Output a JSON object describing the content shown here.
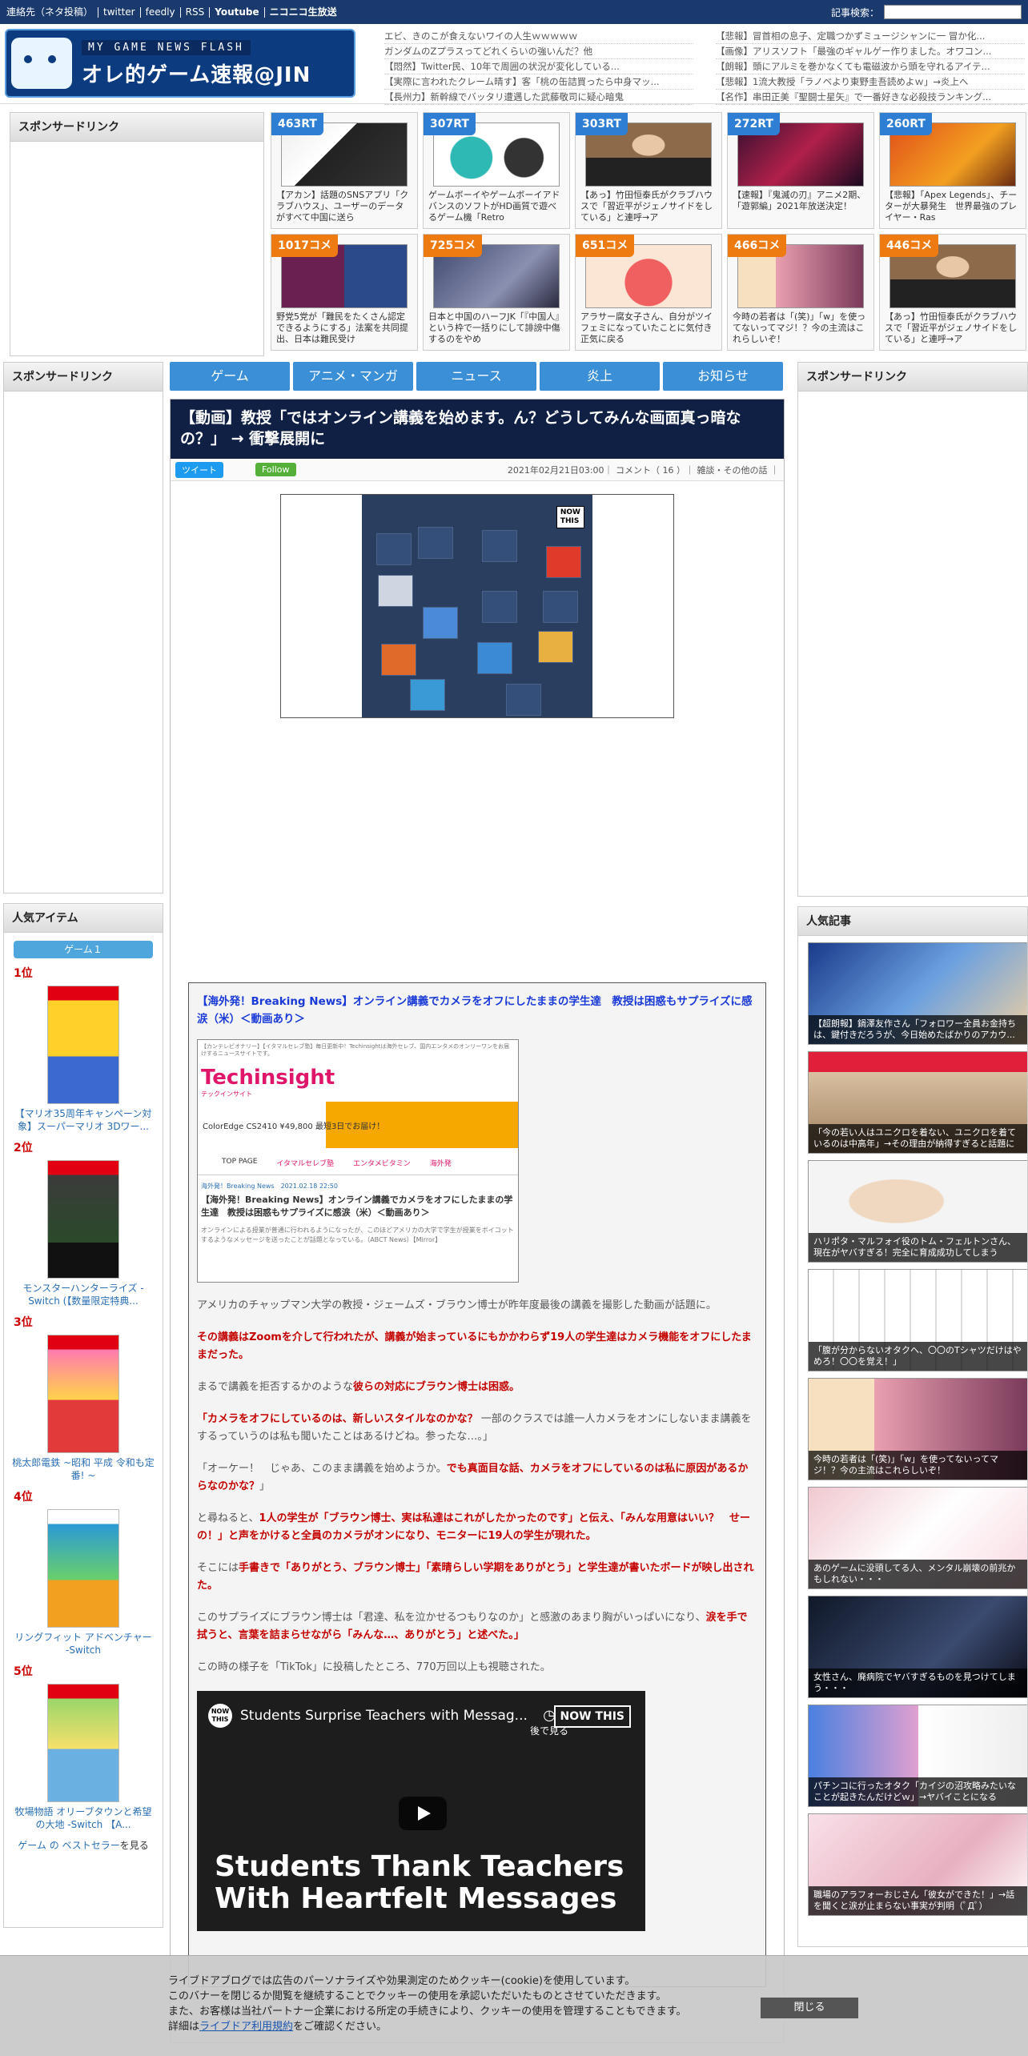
{
  "topbar": {
    "links": [
      "連絡先（ネタ投稿）",
      "twitter",
      "feedly",
      "RSS",
      "Youtube",
      "ニコニコ生放送"
    ],
    "search_label": "記事検索："
  },
  "logo": {
    "sub": "MY GAME NEWS FLASH",
    "main": "オレ的ゲーム速報@JIN"
  },
  "headlines": [
    "エビ、きのこが食えないワイの人生ｗｗｗｗｗ",
    "【悲報】冒首相の息子、定職つかずミュージシャンに一 冒か化...",
    "ガンダムのZプラスってどれくらいの強いんだ？他",
    "【画像】アリスソフト「最強のギャルゲー作りました。オワコン...",
    "【悶然】Twitter民、10年で周囲の状況が変化している...",
    "【朗報】頭にアルミを巻かなくても電磁波から頭を守れるアイテ...",
    "【実際に言われたクレーム晴す】客「桃の缶詰買ったら中身マッ...",
    "【悲報】1流大教授「ラノベより東野圭吾読めよｗ」→炎上へ",
    "【長州力】新幹線でバッタリ遭遇した武藤敬司に疑心暗鬼",
    "【名作】串田正美『聖闘士星矢』で一番好きな必殺技ランキング..."
  ],
  "sponsor_label": "スポンサードリンク",
  "rt_cards": [
    {
      "badge": "463RT",
      "text": "【アカン】話題のSNSアプリ「クラブハウス」、ユーザーのデータがすべて中国に送ら"
    },
    {
      "badge": "307RT",
      "text": "ゲームボーイやゲームボーイアドバンスのソフトがHD画質で遊べるゲーム機「Retro"
    },
    {
      "badge": "303RT",
      "text": "【あっ】竹田恒泰氏がクラブハウスで「習近平がジェノサイドをしている」と連呼→ア"
    },
    {
      "badge": "272RT",
      "text": "【速報】『鬼滅の刃』アニメ2期、「遊郭編」2021年放送決定！"
    },
    {
      "badge": "260RT",
      "text": "【悲報】「Apex Legends」、チーターが大暴発生　世界最強のプレイヤー・Ras"
    },
    {
      "badge": "1017コメ",
      "text": "野党5党が「難民をたくさん認定できるようにする」法案を共同提出、日本は難民受け"
    },
    {
      "badge": "725コメ",
      "text": "日本と中国のハーフJK「『中国人』という枠で一括りにして誹謗中傷するのをやめ"
    },
    {
      "badge": "651コメ",
      "text": "アラサー腐女子さん、自分がツイフェミになっていたことに気付き正気に戻る"
    },
    {
      "badge": "466コメ",
      "text": "今時の若者は「(笑)」「w」を使ってないってマジ！？今の主流はこれらしいぞ！"
    },
    {
      "badge": "446コメ",
      "text": "【あっ】竹田恒泰氏がクラブハウスで「習近平がジェノサイドをしている」と連呼→ア"
    }
  ],
  "nav": [
    "ゲーム",
    "アニメ・マンガ",
    "ニュース",
    "炎上",
    "お知らせ"
  ],
  "article": {
    "title": "【動画】教授「ではオンライン講義を始めます。ん？どうしてみんな画面真っ暗なの？」 → 衝撃展開に",
    "tweet": "ツイート",
    "follow": "Follow",
    "meta": "2021年02月21日03:00｜ コメント（ 16 ）｜ 雑談・その他の話 ｜",
    "quote_title": "【海外発！Breaking News】オンライン講義でカメラをオフにしたままの学生達　教授は困惑もサプライズに感涙（米）＜動画あり＞",
    "qshot": {
      "breadcrumb": "【カンテレビオナリー】【イタマルセレブ塾】毎日更新中！Techinsightは海外セレブ、国内エンタメのオンリーワンをお届けするニュースサイトです。",
      "brand": "Techinsight",
      "brand_sub": "テックインサイト",
      "ad_text": "ColorEdge CS2410 ¥49,800 最短3日でお届け！",
      "nav": [
        "TOP PAGE",
        "イタマルセレブ塾",
        "エンタメビタミン",
        "海外発"
      ],
      "cat": "海外発！Breaking News　2021.02.18 22:50",
      "title": "【海外発！Breaking News】オンライン講義でカメラをオフにしたままの学生達　教授は困惑もサプライズに感涙（米）＜動画あり＞",
      "body": "オンラインによる授業が普通に行われるようになったが、このほどアメリカの大学で学生が授業をボイコットするようなメッセージを送ったことが話題となっている。（ABCT News）【Mirror】"
    },
    "p1": "アメリカのチャップマン大学の教授・ジェームズ・ブラウン博士が昨年度最後の講義を撮影した動画が話題に。",
    "p2": "その講義はZoomを介して行われたが、講義が始まっているにもかかわらず19人の学生達はカメラ機能をオフにしたままだった。",
    "p3a": "まるで講義を拒否するかのような",
    "p3b": "彼らの対応にブラウン博士は困惑。",
    "p4a": "「カメラをオフにしているのは、新しいスタイルなのかな？",
    "p4b": "一部のクラスでは誰一人カメラをオンにしないまま講義をするっていうのは私も聞いたことはあるけどね。参ったな…。」",
    "p5a": "「オーケー！　じゃあ、このまま講義を始めようか。",
    "p5b": "でも真面目な話、カメラをオフにしているのは私に原因があるからなのかな？",
    "p5c": "」",
    "p6a": "と尋ねると、",
    "p6b": "1人の学生が「ブラウン博士、実は私達はこれがしたかったのです」と伝え、「みんな用意はいい？　せーの！」と声をかけると全員のカメラがオンになり、モニターに19人の学生が現れた。",
    "p7a": "そこには",
    "p7b": "手書きで「ありがとう、ブラウン博士」「素晴らしい学期をありがとう」と学生達が書いたボードが映し出された。",
    "p8a": "このサプライズにブラウン博士は「君達、私を泣かせるつもりなのか」と感激のあまり胸がいっぱいになり、",
    "p8b": "涙を手で拭うと、言葉を詰まらせながら「みんな…、ありがとう」と述べた。」",
    "p9": "この時の様子を「TikTok」に投稿したところ、770万回以上も視聴された。",
    "video": {
      "logo": "NOW THIS",
      "title": "Students Surprise Teachers with Messag...",
      "later": "後で見る",
      "nowthis": "NOW THIS",
      "big": "Students Thank Teachers With Heartfelt Messages"
    }
  },
  "popular_items": {
    "label": "人気アイテム",
    "tab": "ゲーム１",
    "items": [
      {
        "rank": "1位",
        "name": "【マリオ35周年キャンペーン対象】スーパーマリオ 3Dワー..."
      },
      {
        "rank": "2位",
        "name": "モンスターハンターライズ -Switch (【数量限定特典..."
      },
      {
        "rank": "3位",
        "name": "桃太郎電鉄 ~昭和 平成 令和も定番! ~"
      },
      {
        "rank": "4位",
        "name": "リングフィット アドベンチャー -Switch"
      },
      {
        "rank": "5位",
        "name": "牧場物語 オリーブタウンと希望の大地 -Switch 【A..."
      }
    ],
    "more_a": "ゲーム の ベストセラー",
    "more_b": "を見る"
  },
  "popular_articles": {
    "label": "人気記事",
    "items": [
      "【超朗報】鍋澤友作さん「フォロワー全員お金持ちは、鍵付きだろうが、今日始めたばかりのアカウ...",
      "「今の若い人はユニクロを着ない、ユニクロを着ているのは中高年」→その理由が納得すぎると話題に",
      "ハリポタ・マルフォイ役のトム・フェルトンさん、現在がヤバすぎる！完全に育成成功してしまう",
      "「腹が分からないオタクへ、〇〇のTシャツだけはやめろ！〇〇を覚え！」",
      "今時の若者は「(笑)」「w」を使ってないってマジ！？今の主流はこれらしいぞ！",
      "あのゲームに没頭してる人、メンタル崩壊の前兆かもしれない・・・",
      "女性さん、廃病院でヤバすぎるものを見つけてしまう・・・",
      "パチンコに行ったオタク「カイジの沼攻略みたいなことが起きたんだけどｗ」→ヤバイことになる",
      "職場のアラフォーおじさん「彼女ができた！」→話を聞くと涙が止まらない事実が判明（ﾟДﾟ）"
    ]
  },
  "cookie": {
    "line1": "ライブドアブログでは広告のパーソナライズや効果測定のためクッキー(cookie)を使用しています。",
    "line2": "このバナーを閉じるか閲覧を継続することでクッキーの使用を承認いただいたものとさせていただきます。",
    "line3": "また、お客様は当社パートナー企業における所定の手続きにより、クッキーの使用を管理することもできます。",
    "line4a": "詳細は",
    "line4b": "ライブドア利用規約",
    "line4c": "をご確認ください。",
    "close": "閉じる"
  }
}
